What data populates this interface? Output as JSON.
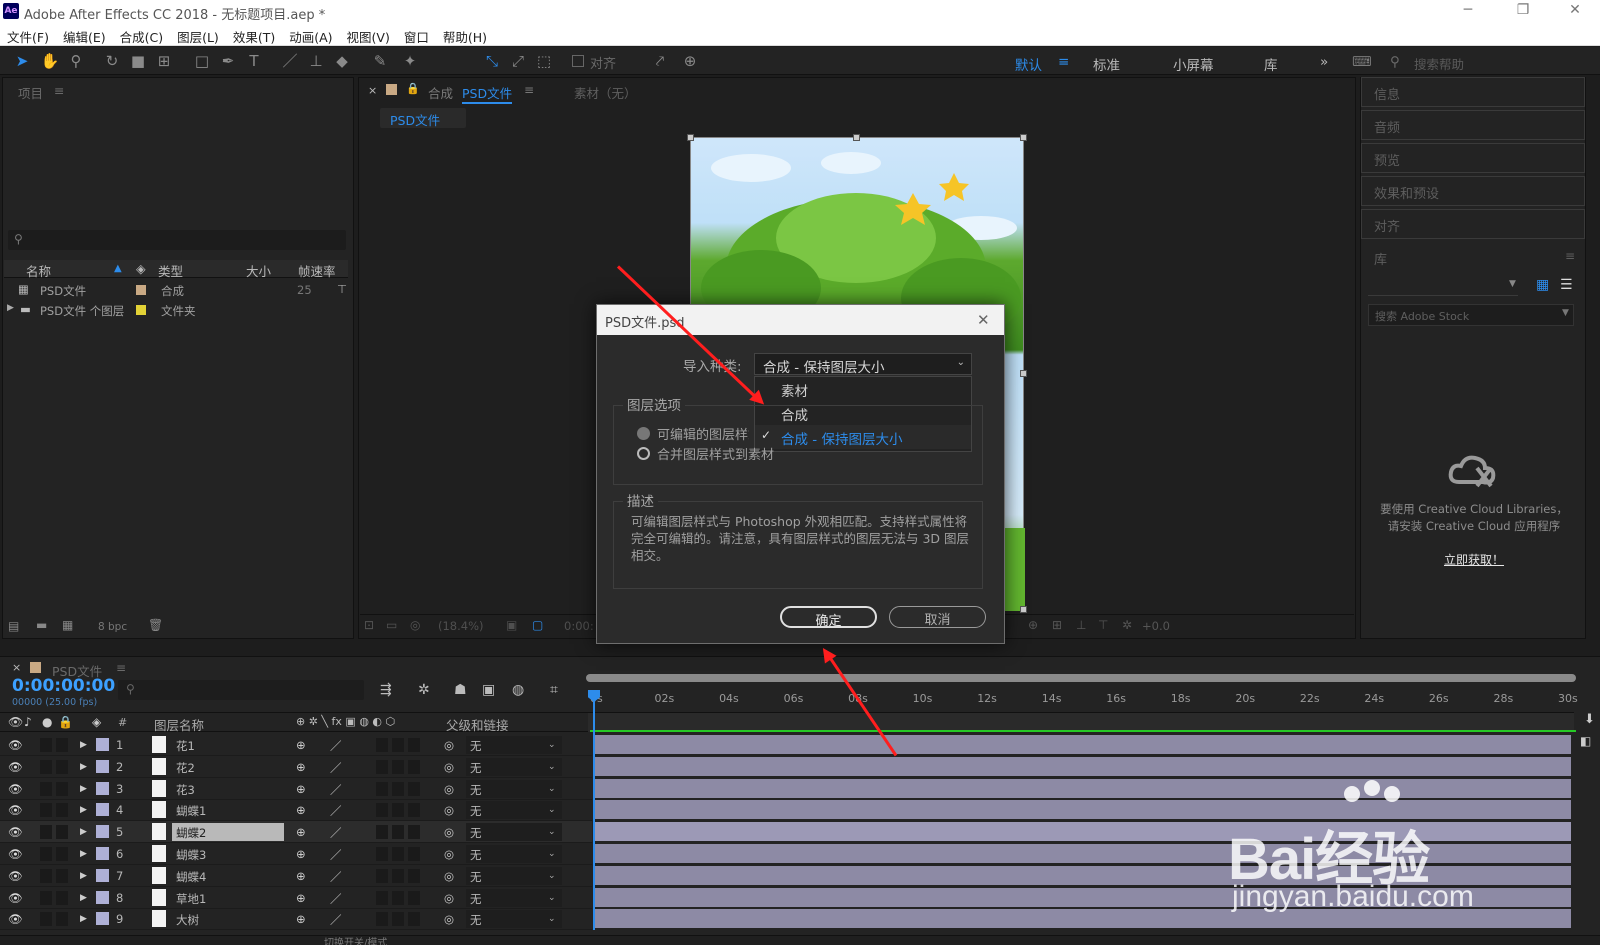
{
  "app": {
    "title": "Adobe After Effects CC 2018 - 无标题项目.aep *",
    "logo": "Ae"
  },
  "menu": [
    "文件(F)",
    "编辑(E)",
    "合成(C)",
    "图层(L)",
    "效果(T)",
    "动画(A)",
    "视图(V)",
    "窗口",
    "帮助(H)"
  ],
  "toolbar": {
    "snap_label": "对齐",
    "workspaces": [
      "默认",
      "标准",
      "小屏幕",
      "库"
    ],
    "search_placeholder": "搜索帮助"
  },
  "project": {
    "panel_title": "项目",
    "columns": {
      "name": "名称",
      "type": "类型",
      "size": "大小",
      "fps": "帧速率"
    },
    "items": [
      {
        "name": "PSD文件",
        "type": "合成",
        "fps": "25"
      },
      {
        "name": "PSD文件 个图层",
        "type": "文件夹",
        "fps": ""
      }
    ],
    "bpc": "8 bpc"
  },
  "composition": {
    "tab_prefix": "合成",
    "tab_name": "PSD文件",
    "footage_tab": "素材（无）",
    "flow_tab": "PSD文件",
    "zoom": "(18.4%)",
    "time": "0:00:",
    "exposure": "+0.0"
  },
  "dialog": {
    "title": "PSD文件.psd",
    "import_kind_label": "导入种类:",
    "import_kind_value": "合成 - 保持图层大小",
    "options": [
      "素材",
      "合成",
      "合成 - 保持图层大小"
    ],
    "selected_option": "合成 - 保持图层大小",
    "layer_options_title": "图层选项",
    "radio_editable": "可编辑的图层样式",
    "radio_merge": "合并图层样式到素材",
    "description_title": "描述",
    "description_text": "可编辑图层样式与 Photoshop 外观相匹配。支持样式属性将完全可编辑的。请注意，具有图层样式的图层无法与 3D 图层相交。",
    "ok": "确定",
    "cancel": "取消"
  },
  "right_panels": {
    "panels": [
      "信息",
      "音频",
      "预览",
      "效果和预设",
      "对齐"
    ],
    "library_title": "库",
    "stock_search": "搜索 Adobe Stock",
    "cc_message_1": "要使用 Creative Cloud Libraries，",
    "cc_message_2": "请安装 Creative Cloud 应用程序",
    "cc_link": "立即获取！"
  },
  "timeline": {
    "comp_name": "PSD文件",
    "timecode": "0:00:00:00",
    "frames": "00000 (25.00 fps)",
    "col_layer_name": "图层名称",
    "col_parent": "父级和链接",
    "col_index": "#",
    "ruler": [
      "0s",
      "02s",
      "04s",
      "06s",
      "08s",
      "10s",
      "12s",
      "14s",
      "16s",
      "18s",
      "20s",
      "22s",
      "24s",
      "26s",
      "28s",
      "30s"
    ],
    "layers": [
      {
        "index": "1",
        "name": "花1",
        "parent": "无"
      },
      {
        "index": "2",
        "name": "花2",
        "parent": "无"
      },
      {
        "index": "3",
        "name": "花3",
        "parent": "无"
      },
      {
        "index": "4",
        "name": "蝴蝶1",
        "parent": "无"
      },
      {
        "index": "5",
        "name": "蝴蝶2",
        "parent": "无"
      },
      {
        "index": "6",
        "name": "蝴蝶3",
        "parent": "无"
      },
      {
        "index": "7",
        "name": "蝴蝶4",
        "parent": "无"
      },
      {
        "index": "8",
        "name": "草地1",
        "parent": "无"
      },
      {
        "index": "9",
        "name": "大树",
        "parent": "无"
      }
    ],
    "footer": "切换开关/模式"
  },
  "watermark": {
    "brand": "Bai经验",
    "url": "jingyan.baidu.com"
  },
  "colors": {
    "accent": "#2d8ceb",
    "annotation": "#ff1e1e",
    "layer_bar": "#8d8aa5",
    "timecode": "#3ca0ff"
  }
}
